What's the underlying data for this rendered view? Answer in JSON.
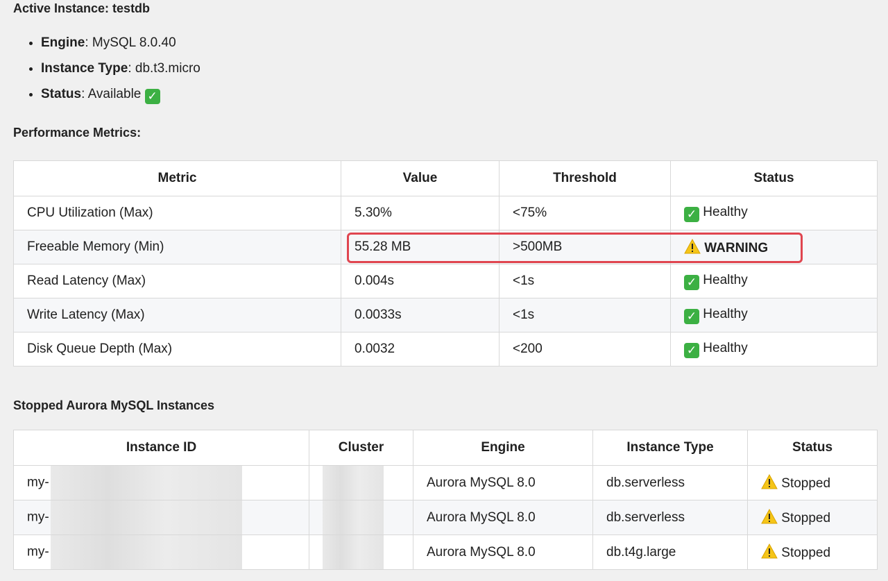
{
  "active": {
    "heading": "Active Instance: testdb",
    "items": [
      {
        "key": "Engine",
        "value": "MySQL 8.0.40"
      },
      {
        "key": "Instance Type",
        "value": "db.t3.micro"
      },
      {
        "key": "Status",
        "value": "Available",
        "icon": "check-icon"
      }
    ]
  },
  "performance": {
    "heading": "Performance Metrics:",
    "columns": [
      "Metric",
      "Value",
      "Threshold",
      "Status"
    ],
    "rows": [
      {
        "metric": "CPU Utilization (Max)",
        "value": "5.30%",
        "threshold": "<75%",
        "status": "Healthy",
        "icon": "check-icon"
      },
      {
        "metric": "Freeable Memory (Min)",
        "value": "55.28 MB",
        "threshold": ">500MB",
        "status": "WARNING",
        "icon": "warning-icon"
      },
      {
        "metric": "Read Latency (Max)",
        "value": "0.004s",
        "threshold": "<1s",
        "status": "Healthy",
        "icon": "check-icon"
      },
      {
        "metric": "Write Latency (Max)",
        "value": "0.0033s",
        "threshold": "<1s",
        "status": "Healthy",
        "icon": "check-icon"
      },
      {
        "metric": "Disk Queue Depth (Max)",
        "value": "0.0032",
        "threshold": "<200",
        "status": "Healthy",
        "icon": "check-icon"
      }
    ]
  },
  "stopped": {
    "heading": "Stopped Aurora MySQL Instances",
    "columns": [
      "Instance ID",
      "Cluster",
      "Engine",
      "Instance Type",
      "Status"
    ],
    "rows": [
      {
        "id": "my-",
        "engine": "Aurora MySQL 8.0",
        "type": "db.serverless",
        "status": "Stopped",
        "icon": "warning-icon"
      },
      {
        "id": "my-",
        "engine": "Aurora MySQL 8.0",
        "type": "db.serverless",
        "status": "Stopped",
        "icon": "warning-icon"
      },
      {
        "id": "my-",
        "engine": "Aurora MySQL 8.0",
        "type": "db.t4g.large",
        "status": "Stopped",
        "icon": "warning-icon"
      }
    ]
  },
  "colors": {
    "highlight": "#e0454f",
    "check": "#3cb043",
    "warning": "#f5c518"
  }
}
